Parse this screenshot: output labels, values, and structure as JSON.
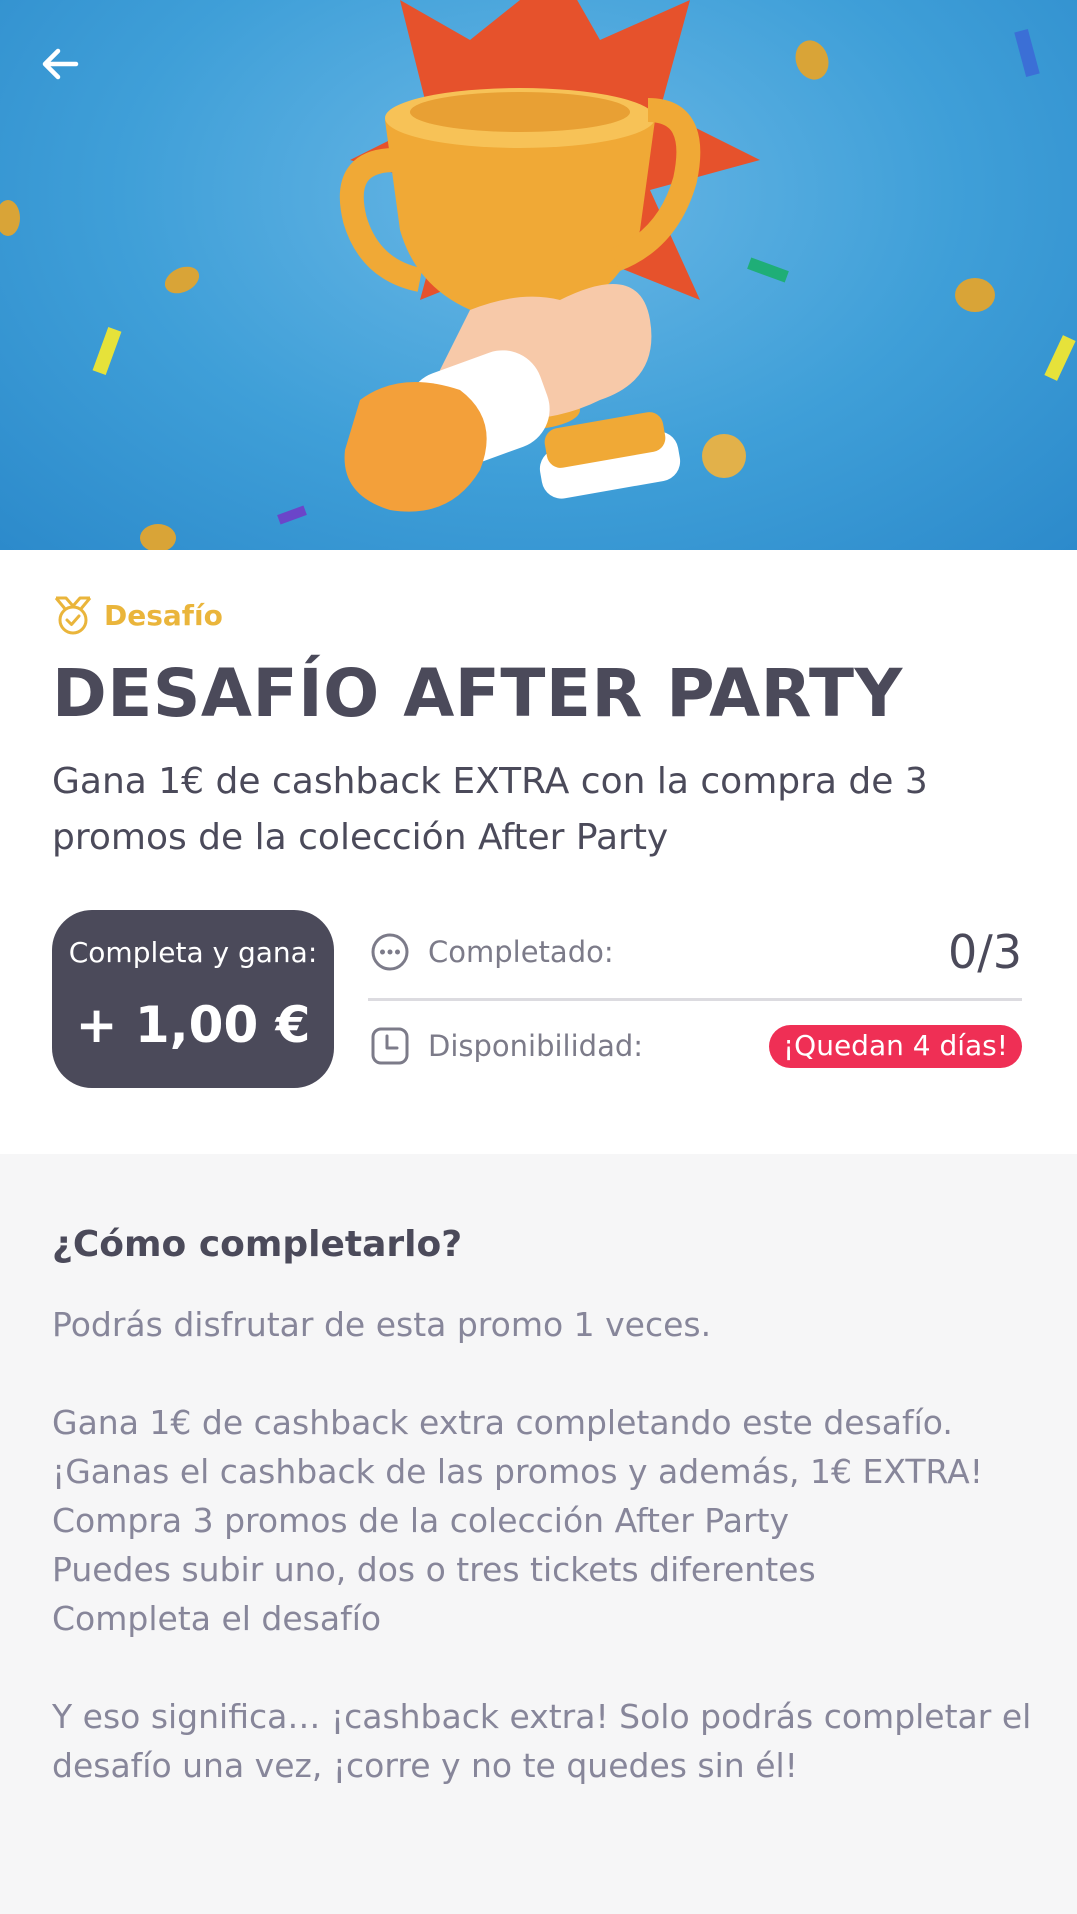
{
  "hero": {
    "image_description_icon": "trophy-illustration"
  },
  "tag": {
    "icon": "medal-icon",
    "label": "Desafío"
  },
  "title": "DESAFÍO AFTER PARTY",
  "subtitle": "Gana 1€ de cashback EXTRA con la compra de 3 promos de la colección After Party",
  "reward": {
    "label": "Completa y gana:",
    "amount": "+ 1,00 €"
  },
  "progress": {
    "icon": "more-dots-icon",
    "label": "Completado:",
    "value": "0/3",
    "fraction": 0
  },
  "availability": {
    "icon": "clock-icon",
    "label": "Disponibilidad:",
    "badge": "¡Quedan 4 días!"
  },
  "howto": {
    "title": "¿Cómo completarlo?",
    "line1": "Podrás disfrutar de esta promo 1 veces.",
    "line2": "Gana 1€ de cashback extra completando este desafío.",
    "line3": "¡Ganas el cashback de las promos y además, 1€ EXTRA!",
    "line4": "Compra 3 promos de la colección After Party",
    "line5": "Puedes subir uno, dos o tres tickets diferentes",
    "line6": "Completa el desafío",
    "line7": "Y eso significa… ¡cashback extra! Solo podrás completar el desafío una vez, ¡corre y no te quedes sin él!"
  },
  "colors": {
    "accent": "#eab53b",
    "primary_text": "#4b4a5a",
    "badge": "#ef2f55",
    "hero_bg": "#3f9fd8"
  }
}
